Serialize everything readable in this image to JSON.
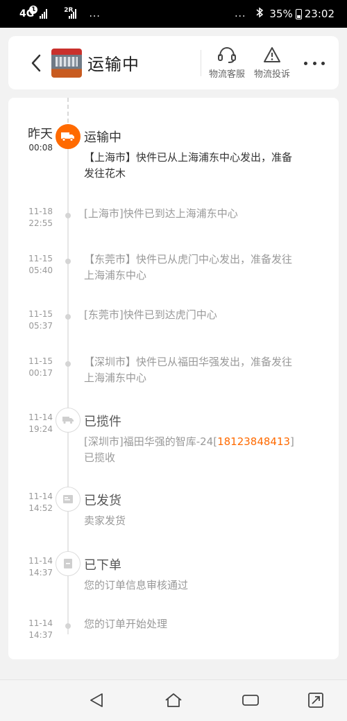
{
  "status_bar": {
    "network": "4G",
    "sim1_badge": "1",
    "sim2": "2R",
    "dots_left": "...",
    "dots_right": "...",
    "battery": "35%",
    "time": "23:02"
  },
  "header": {
    "title": "运输中",
    "customer_service_label": "物流客服",
    "complaint_label": "物流投诉"
  },
  "timeline": {
    "current": {
      "day": "昨天",
      "time": "00:08",
      "status": "运输中",
      "text": "【上海市】快件已从上海浦东中心发出，准备发往花木"
    },
    "events": [
      {
        "date": "11-18",
        "time": "22:55",
        "text": "[上海市]快件已到达上海浦东中心"
      },
      {
        "date": "11-15",
        "time": "05:40",
        "text": "【东莞市】快件已从虎门中心发出，准备发往上海浦东中心"
      },
      {
        "date": "11-15",
        "time": "05:37",
        "text": "[东莞市]快件已到达虎门中心"
      },
      {
        "date": "11-15",
        "time": "00:17",
        "text": "【深圳市】快件已从福田华强发出，准备发往上海浦东中心"
      }
    ],
    "pickup": {
      "date": "11-14",
      "time": "19:24",
      "status": "已揽件",
      "text_prefix": "[深圳市]福田华强的智库-24[",
      "phone": "18123848413",
      "text_suffix": "]",
      "text_line2": "已揽收"
    },
    "shipped": {
      "date": "11-14",
      "time": "14:52",
      "status": "已发货",
      "text": "卖家发货"
    },
    "ordered": {
      "date": "11-14",
      "time": "14:37",
      "status": "已下单",
      "text": "您的订单信息审核通过"
    },
    "processing": {
      "date": "11-14",
      "time": "14:37",
      "text": "您的订单开始处理"
    }
  },
  "colors": {
    "accent": "#ff6a00",
    "muted_text": "#999999",
    "primary_text": "#333333"
  }
}
